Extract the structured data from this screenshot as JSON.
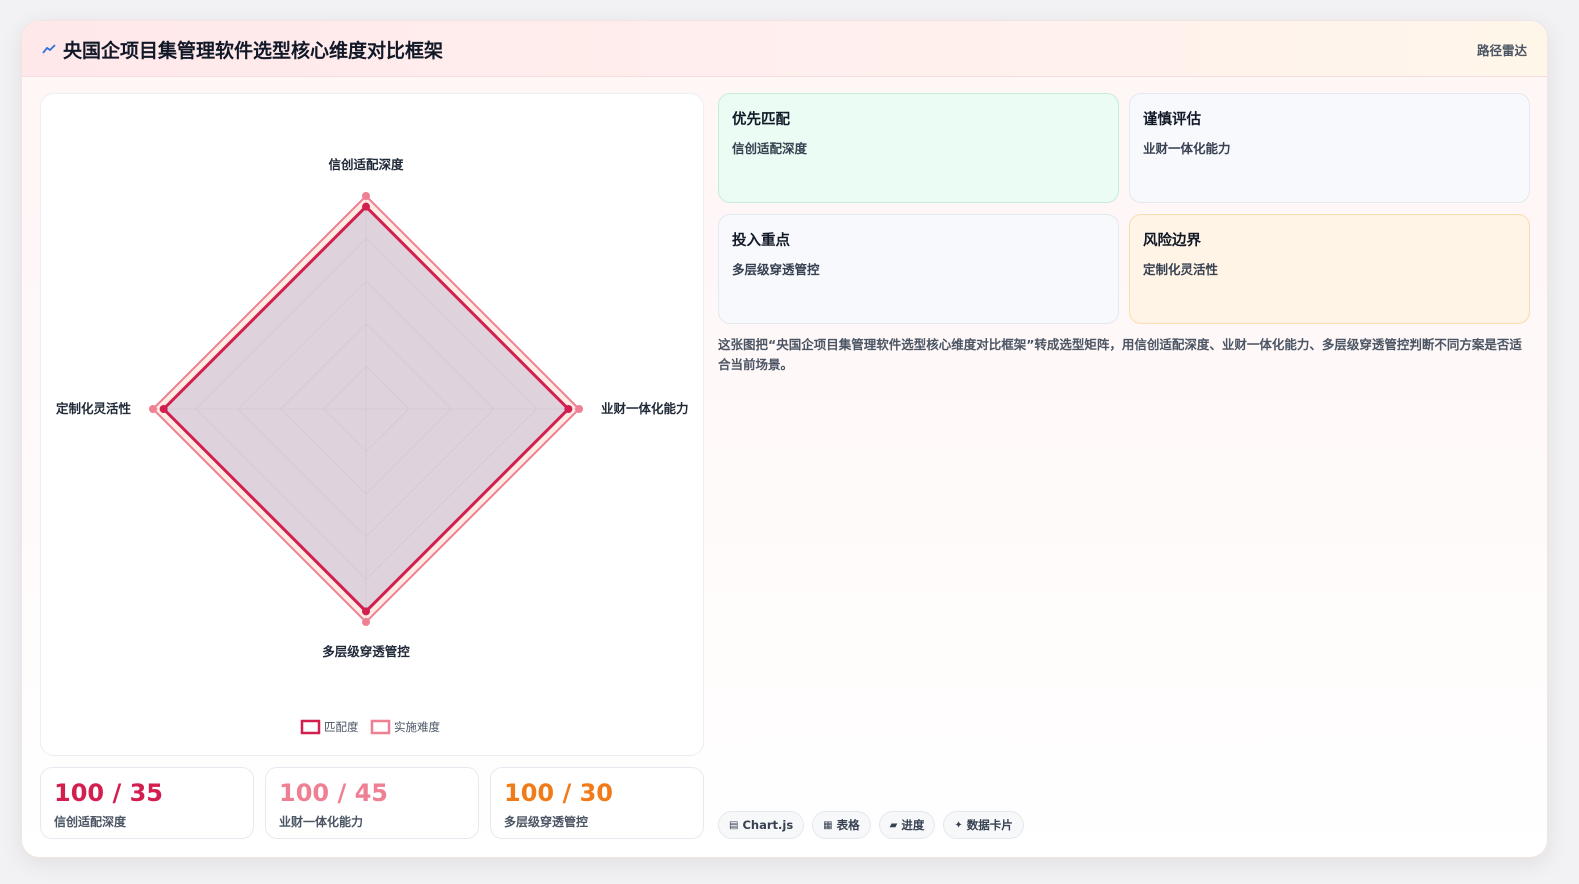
{
  "header": {
    "title": "央国企项目集管理软件选型核心维度对比框架",
    "badge": "路径雷达"
  },
  "chart_data": {
    "type": "radar",
    "axes": [
      "信创适配深度",
      "业财一体化能力",
      "多层级穿透管控",
      "定制化灵活性"
    ],
    "rmax": 100,
    "series": [
      {
        "name": "匹配度",
        "values": [
          95,
          95,
          95,
          95
        ],
        "color": "#d21f4f"
      },
      {
        "name": "实施难度",
        "values": [
          100,
          100,
          100,
          100
        ],
        "color": "#ef7f92"
      }
    ]
  },
  "stats": [
    {
      "value": "100 / 35",
      "label": "信创适配深度",
      "color": "#d21f4f"
    },
    {
      "value": "100 / 45",
      "label": "业财一体化能力",
      "color": "#ef7f92"
    },
    {
      "value": "100 / 30",
      "label": "多层级穿透管控",
      "color": "#f07b18"
    }
  ],
  "quadrants": [
    {
      "title": "优先匹配",
      "sub": "信创适配深度"
    },
    {
      "title": "谨慎评估",
      "sub": "业财一体化能力"
    },
    {
      "title": "投入重点",
      "sub": "多层级穿透管控"
    },
    {
      "title": "风险边界",
      "sub": "定制化灵活性"
    }
  ],
  "description": "这张图把“央国企项目集管理软件选型核心维度对比框架”转成选型矩阵，用信创适配深度、业财一体化能力、多层级穿透管控判断不同方案是否适合当前场景。",
  "tags": [
    {
      "icon": "▤",
      "label": "Chart.js"
    },
    {
      "icon": "▦",
      "label": "表格"
    },
    {
      "icon": "▰",
      "label": "进度"
    },
    {
      "icon": "✦",
      "label": "数据卡片"
    }
  ],
  "colors": {
    "primary": "#d21f4f",
    "secondary": "#ef7f92",
    "accent": "#f07b18"
  }
}
